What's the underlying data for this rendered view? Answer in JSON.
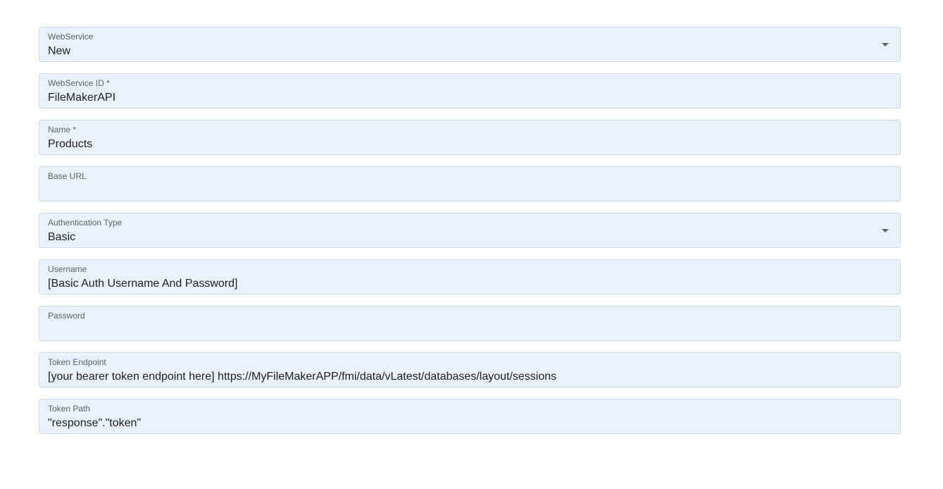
{
  "form": {
    "webservice": {
      "label": "WebService",
      "value": "New",
      "icon": "chevron-down-icon"
    },
    "webservice_id": {
      "label": "WebService ID *",
      "value": "FileMakerAPI"
    },
    "name": {
      "label": "Name *",
      "value": "Products"
    },
    "base_url": {
      "label": "Base URL",
      "value": ""
    },
    "auth_type": {
      "label": "Authentication Type",
      "value": "Basic",
      "icon": "chevron-down-icon"
    },
    "username": {
      "label": "Username",
      "value": "[Basic Auth Username And Password]"
    },
    "password": {
      "label": "Password",
      "value": ""
    },
    "token_endpoint": {
      "label": "Token Endpoint",
      "value": "[your bearer token endpoint here]  https://MyFileMakerAPP/fmi/data/vLatest/databases/layout/sessions"
    },
    "token_path": {
      "label": "Token Path",
      "value": "\"response\".\"token\""
    }
  },
  "colors": {
    "field_background": "#e8f1fc",
    "field_border": "#c9d9ec",
    "label_text": "#5f6368",
    "value_text": "#212121"
  }
}
